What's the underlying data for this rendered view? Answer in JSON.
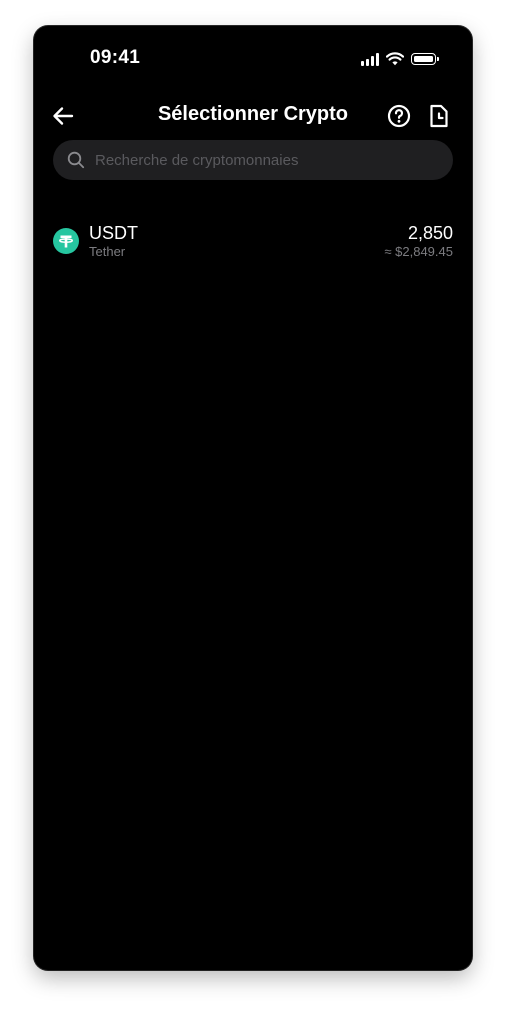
{
  "status_bar": {
    "time": "09:41",
    "icons": [
      "cellular-signal-icon",
      "wifi-icon",
      "battery-icon"
    ]
  },
  "header": {
    "title": "Sélectionner Crypto",
    "back_icon": "arrow-left-icon",
    "help_icon": "question-circle-icon",
    "history_icon": "document-clock-icon"
  },
  "search": {
    "placeholder": "Recherche de cryptomonnaies",
    "value": "",
    "icon": "search-icon"
  },
  "crypto_list": [
    {
      "symbol": "USDT",
      "name": "Tether",
      "amount": "2,850",
      "fiat_value": "≈ $2,849.45",
      "icon": "tether-icon",
      "icon_color": "#26c6a0"
    }
  ],
  "colors": {
    "background": "#000000",
    "search_background": "#1f1f21",
    "secondary_text": "#7c7c80",
    "tether_green": "#26c6a0"
  }
}
